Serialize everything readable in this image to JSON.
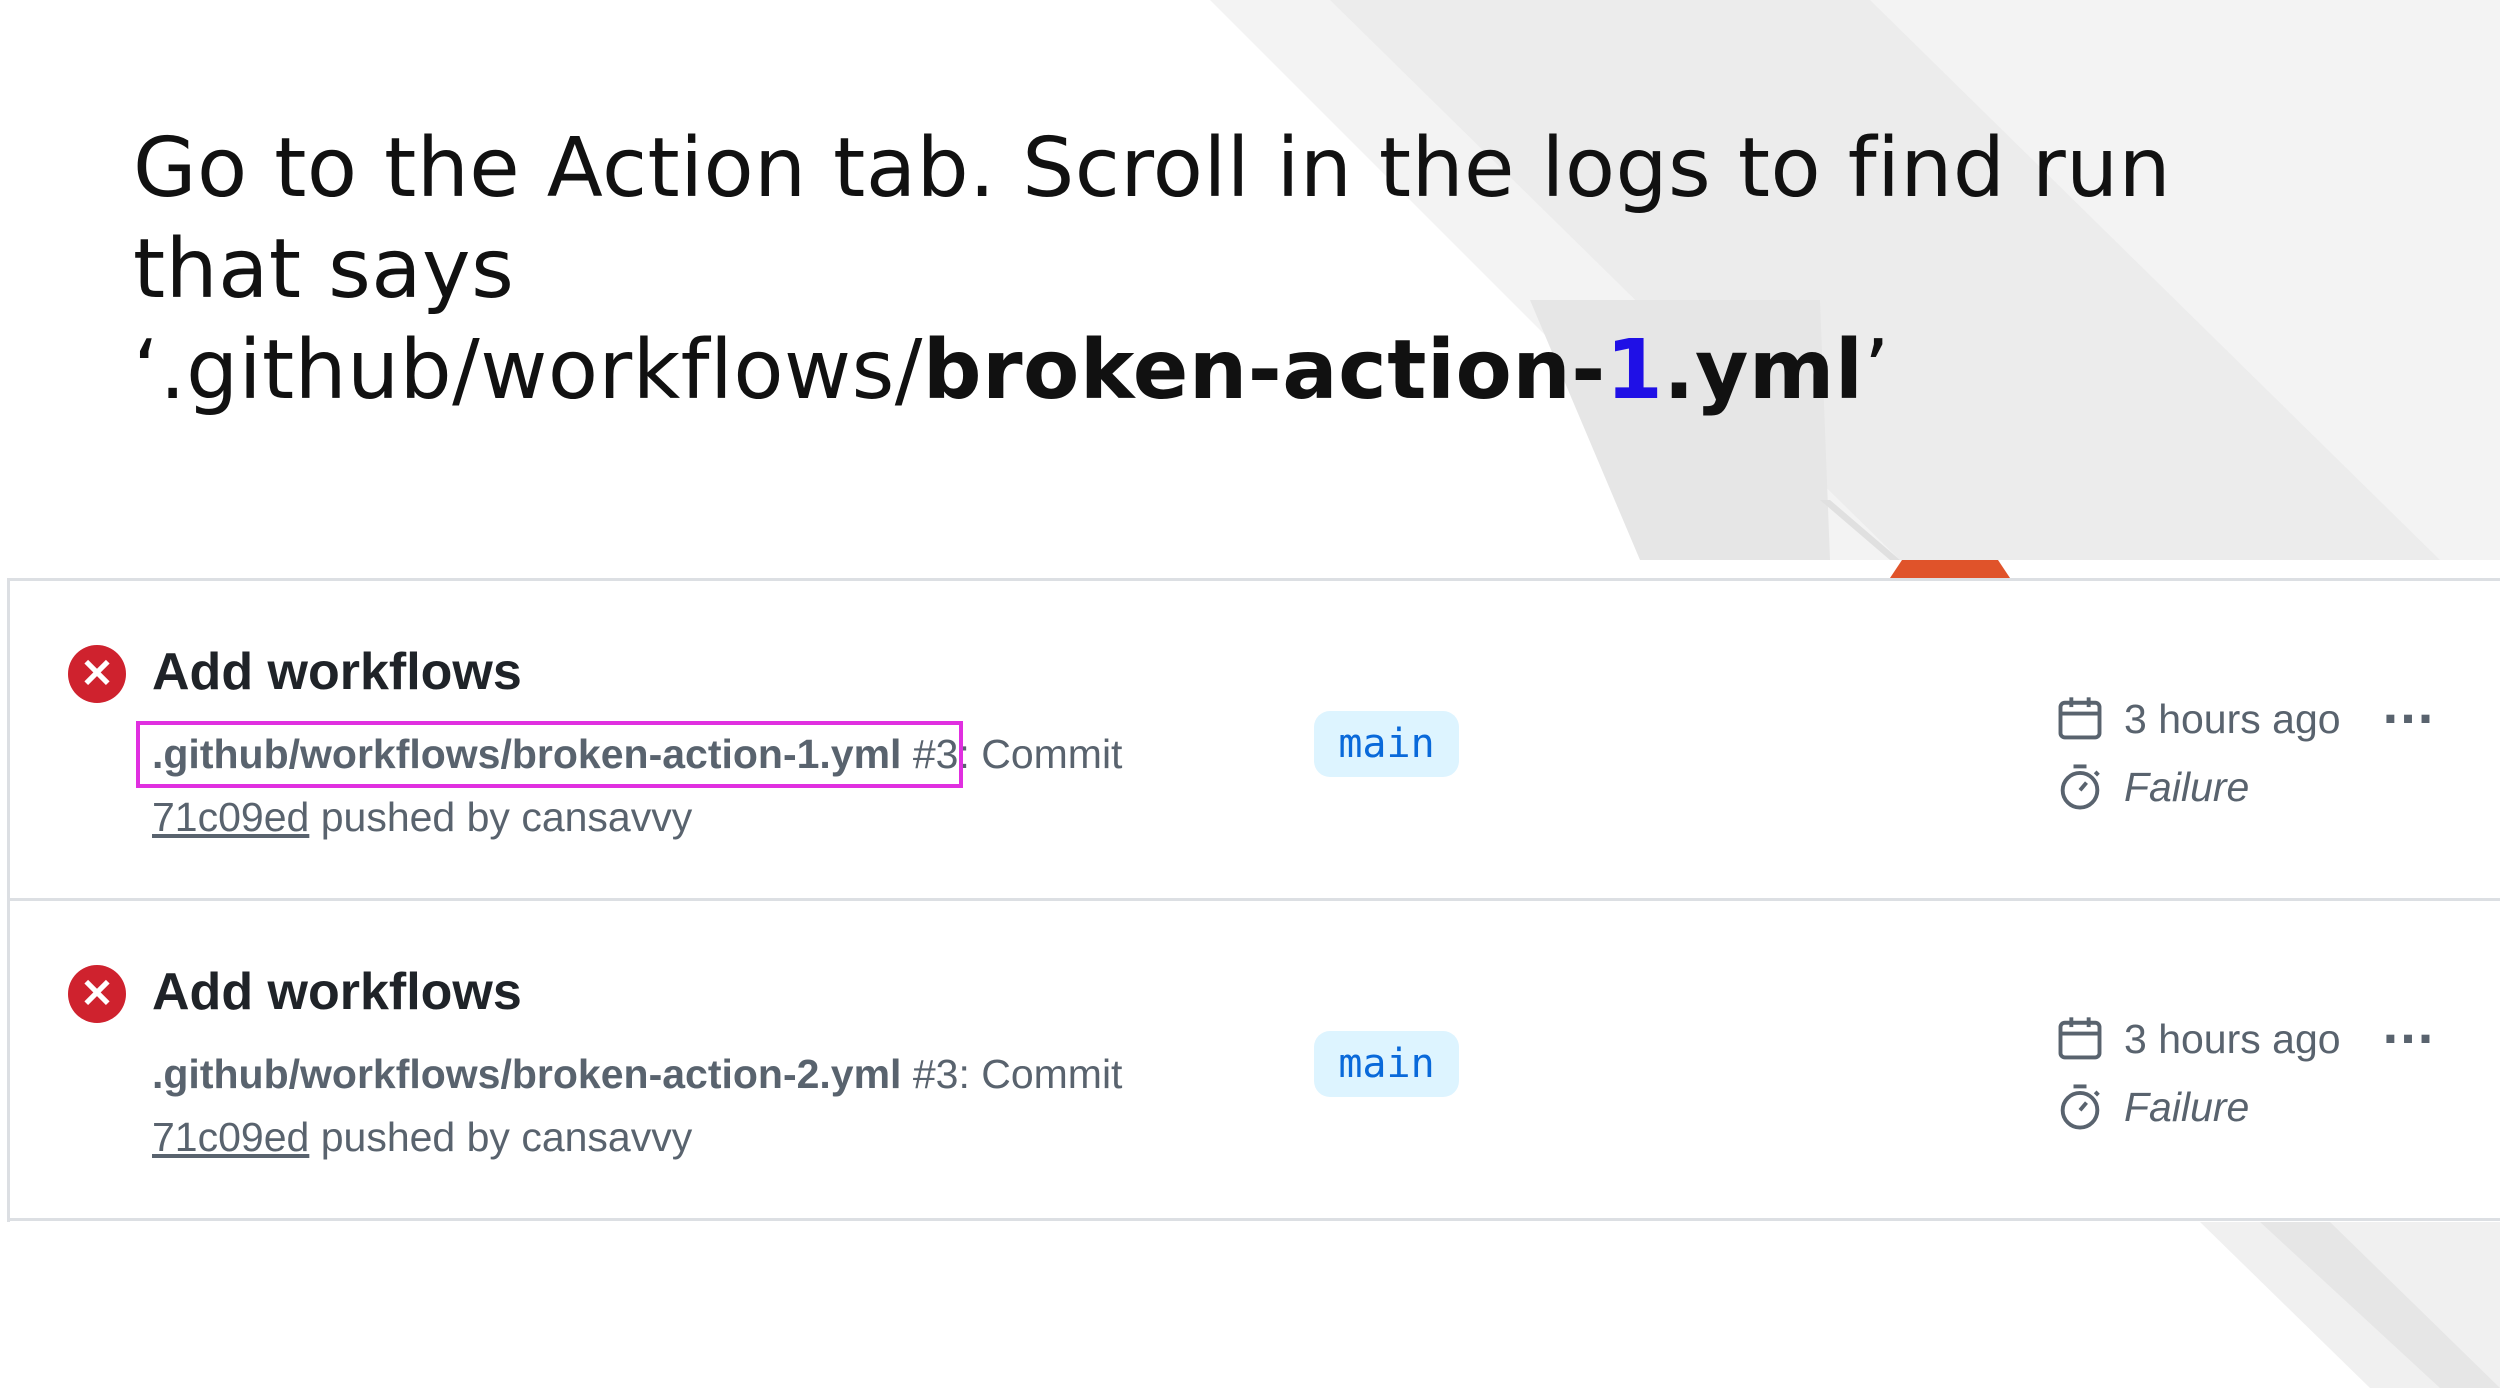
{
  "headline": {
    "line1": "Go to the Action tab. Scroll in the logs to find run",
    "line2": "that says",
    "line3_open_quote": "‘",
    "line3_prefix": ".github/workflows/",
    "line3_bold": "broken-action-",
    "line3_accent": "1",
    "line3_bold_suffix": ".yml",
    "line3_close_quote": "’"
  },
  "runs": [
    {
      "title": "Add workflows",
      "workflow_file": ".github/workflows/broken-action-1.yml",
      "run_info": " #3: Commit",
      "commit_sha": "71c09ed",
      "pushed_by": " pushed by cansavvy",
      "branch": "main",
      "time": "3 hours ago",
      "status": "Failure",
      "status_icon": "x-circle-icon",
      "more_icon": "kebab-horizontal-icon",
      "more_label": "..."
    },
    {
      "title": "Add workflows",
      "workflow_file": ".github/workflows/broken-action-2.yml",
      "run_info": " #3: Commit",
      "commit_sha": "71c09ed",
      "pushed_by": " pushed by cansavvy",
      "branch": "main",
      "time": "3 hours ago",
      "status": "Failure",
      "status_icon": "x-circle-icon",
      "more_icon": "kebab-horizontal-icon",
      "more_label": "..."
    }
  ],
  "colors": {
    "failure_red": "#cf222e",
    "branch_bg": "#ddf4ff",
    "branch_text": "#0969da",
    "highlight_magenta": "#e02fe0",
    "accent_blue": "#1f10e6",
    "orange_accent": "#e0532a"
  }
}
